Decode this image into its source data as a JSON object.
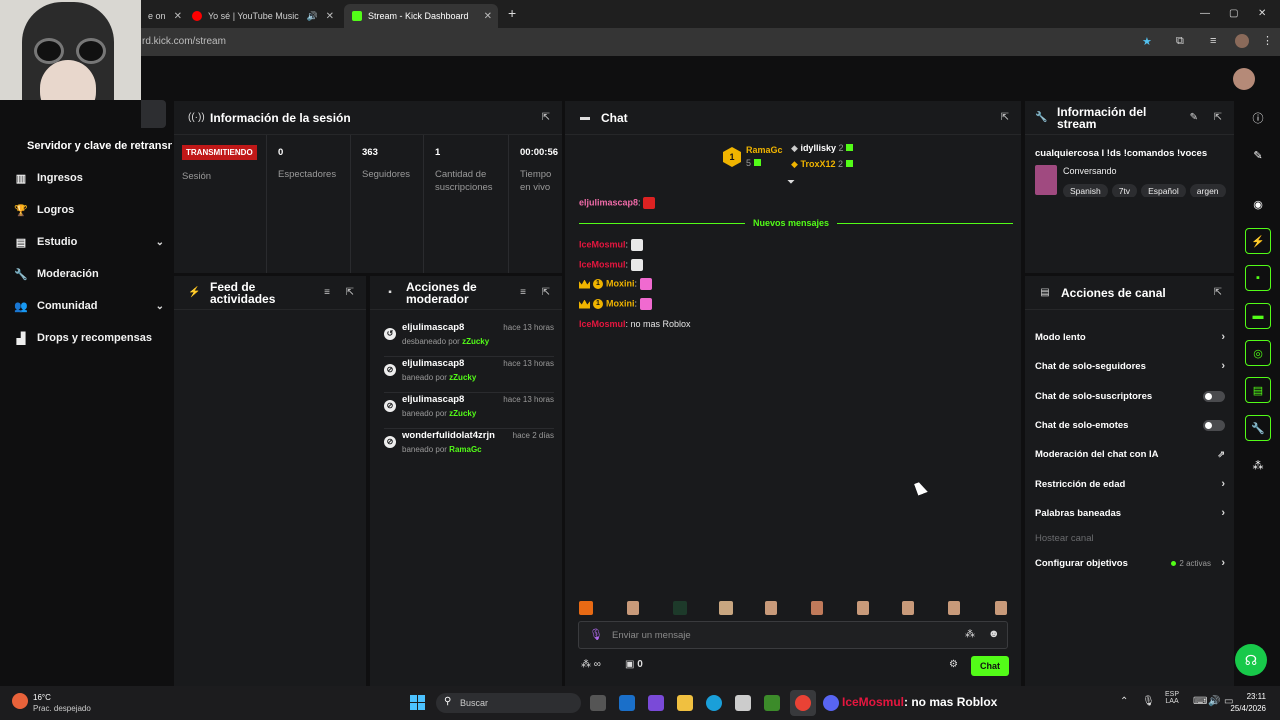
{
  "browser": {
    "tabs": [
      {
        "label": "e on",
        "close": "✕"
      },
      {
        "label": "Yo sé | YouTube Music",
        "close": "✕"
      },
      {
        "label": "Stream - Kick Dashboard",
        "close": "✕"
      }
    ],
    "new_tab": "+",
    "url": "rd.kick.com/stream",
    "win_min": "—",
    "win_max": "▢",
    "win_close": "✕"
  },
  "sidebar": {
    "truncated_label": "Servidor y clave de retransn",
    "items": [
      {
        "label": "Ingresos",
        "icon": "▥"
      },
      {
        "label": "Logros",
        "icon": "🏆"
      },
      {
        "label": "Estudio",
        "icon": "▤",
        "chev": "⌄"
      },
      {
        "label": "Moderación",
        "icon": "🔧"
      },
      {
        "label": "Comunidad",
        "icon": "👥",
        "chev": "⌄"
      },
      {
        "label": "Drops y recompensas",
        "icon": "▟"
      }
    ]
  },
  "session": {
    "title": "Información de la sesión",
    "badge": "TRANSMITIENDO",
    "badge_label": "Sesión",
    "stats": [
      {
        "value": "0",
        "label": "Espectadores"
      },
      {
        "value": "363",
        "label": "Seguidores"
      },
      {
        "value": "1",
        "label": "Cantidad de suscripciones"
      },
      {
        "value": "00:00:56",
        "label": "Tiempo en vivo"
      }
    ]
  },
  "feed": {
    "title": "Feed de actividades"
  },
  "mod_actions": {
    "title": "Acciones de moderador",
    "rows": [
      {
        "icon": "↺",
        "user": "eljulimascap8",
        "time": "hace 13 horas",
        "action": "desbaneado por",
        "by": "zZucky"
      },
      {
        "icon": "⊘",
        "user": "eljulimascap8",
        "time": "hace 13 horas",
        "action": "baneado por",
        "by": "zZucky"
      },
      {
        "icon": "⊘",
        "user": "eljulimascap8",
        "time": "hace 13 horas",
        "action": "baneado por",
        "by": "zZucky"
      },
      {
        "icon": "⊘",
        "user": "wonderfulidolat4zrjn",
        "time": "hace 2 días",
        "action": "baneado por",
        "by": "RamaGc"
      }
    ]
  },
  "chat": {
    "title": "Chat",
    "top": [
      {
        "name": "RamaGc",
        "count": "5"
      },
      {
        "name": "idyllisky",
        "count": "2"
      },
      {
        "name": "TroxX12",
        "count": "2"
      }
    ],
    "rank": "1",
    "pinned_user": "eljulimascap8",
    "new_messages": "Nuevos mensajes",
    "messages": [
      {
        "user": "IceMosmul",
        "text": ""
      },
      {
        "user": "IceMosmul",
        "text": ""
      },
      {
        "user": "Moxini",
        "text": ""
      },
      {
        "user": "Moxini",
        "text": ""
      },
      {
        "user": "IceMosmul",
        "text": "no mas Roblox"
      }
    ],
    "sub_badge": "1",
    "input_placeholder": "Enviar un mensaje",
    "infinity": "∞",
    "points": "0",
    "send": "Chat"
  },
  "stream_info": {
    "title": "Información del stream",
    "stream_title": "cualquiercosa l !ds !comandos !voces",
    "category": "Conversando",
    "tags": [
      "Spanish",
      "7tv",
      "Español",
      "argen"
    ]
  },
  "channel_actions": {
    "title": "Acciones de canal",
    "items": [
      {
        "label": "Modo lento",
        "kind": "chevron"
      },
      {
        "label": "Chat de solo-seguidores",
        "kind": "chevron"
      },
      {
        "label": "Chat de solo-suscriptores",
        "kind": "toggle"
      },
      {
        "label": "Chat de solo-emotes",
        "kind": "toggle"
      },
      {
        "label": "Moderación del chat con IA",
        "kind": "external"
      },
      {
        "label": "Restricción de edad",
        "kind": "chevron"
      },
      {
        "label": "Palabras baneadas",
        "kind": "chevron"
      },
      {
        "label": "Hostear canal",
        "kind": "disabled"
      },
      {
        "label": "Configurar objetivos",
        "kind": "goals",
        "extra": "2 activas"
      }
    ]
  },
  "taskbar": {
    "weather_temp": "16°C",
    "weather_desc": "Prac. despejado",
    "search": "Buscar",
    "notif_user": "IceMosmul",
    "notif_text": ": no mas Roblox",
    "lang_top": "ESP",
    "lang_bottom": "LAA",
    "time": "23:11",
    "date": "25/4/2026"
  },
  "colors": {
    "accent": "#53fc18",
    "live": "#c01818",
    "panel": "#191a1c"
  }
}
